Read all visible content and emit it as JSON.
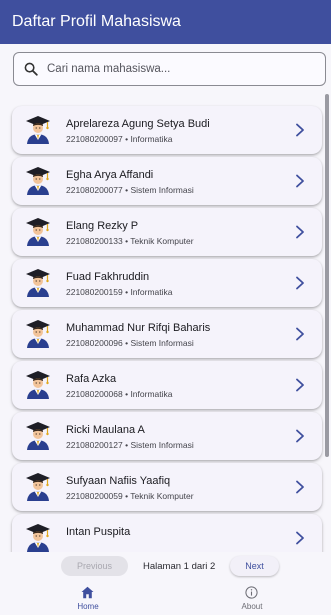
{
  "appbar": {
    "title": "Daftar Profil Mahasiswa"
  },
  "search": {
    "placeholder": "Cari nama mahasiswa..."
  },
  "students": [
    {
      "name": "Aprelareza Agung Setya Budi",
      "nim": "221080200097",
      "prodi": "Informatika"
    },
    {
      "name": "Egha Arya Affandi",
      "nim": "221080200077",
      "prodi": "Sistem Informasi"
    },
    {
      "name": "Elang Rezky P",
      "nim": "221080200133",
      "prodi": "Teknik Komputer"
    },
    {
      "name": "Fuad Fakhruddin",
      "nim": "221080200159",
      "prodi": "Informatika"
    },
    {
      "name": "Muhammad Nur Rifqi Baharis",
      "nim": "221080200096",
      "prodi": "Sistem Informasi"
    },
    {
      "name": "Rafa Azka",
      "nim": "221080200068",
      "prodi": "Informatika"
    },
    {
      "name": "Ricki Maulana A",
      "nim": "221080200127",
      "prodi": "Sistem Informasi"
    },
    {
      "name": "Sufyaan Nafiis Yaafiq",
      "nim": "221080200059",
      "prodi": "Teknik Komputer"
    },
    {
      "name": "Intan Puspita",
      "nim": "",
      "prodi": ""
    }
  ],
  "pagination": {
    "previous_label": "Previous",
    "page_label": "Halaman 1 dari 2",
    "next_label": "Next"
  },
  "bottom_nav": {
    "items": [
      {
        "label": "Home",
        "icon": "home-icon",
        "active": true
      },
      {
        "label": "About",
        "icon": "info-icon",
        "active": false
      }
    ]
  },
  "colors": {
    "primary": "#3f4f9e",
    "background": "#f7f6fb",
    "card": "#f5f3fb",
    "nav_inactive": "#6c6c74"
  }
}
